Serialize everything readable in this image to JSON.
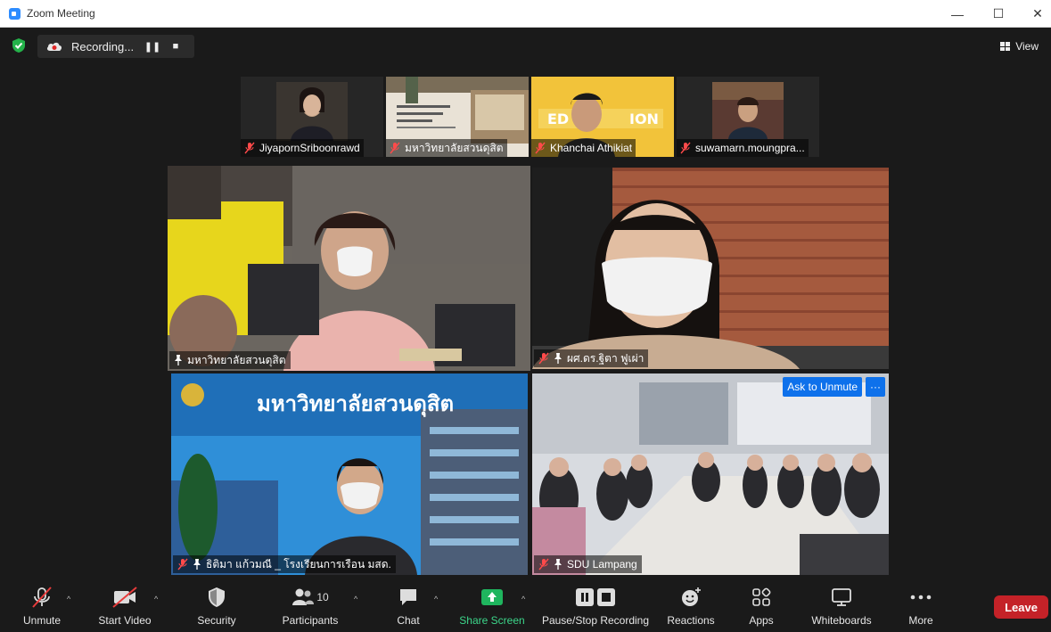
{
  "window": {
    "title": "Zoom Meeting",
    "minimize": "—",
    "maximize": "☐",
    "close": "✕"
  },
  "recording": {
    "label": "Recording...",
    "pause": "❚❚",
    "stop": "■"
  },
  "view": {
    "label": "View"
  },
  "thumbnails": [
    {
      "name": "JiyapornSriboonrawd",
      "muted": true
    },
    {
      "name": "มหาวิทยาลัยสวนดุสิต",
      "muted": true
    },
    {
      "name": "Khanchai Athikiat",
      "muted": true
    },
    {
      "name": "suwamarn.moungpra...",
      "muted": true
    }
  ],
  "tiles": [
    {
      "name": "มหาวิทยาลัยสวนดุสิต",
      "muted": false,
      "pinned": true,
      "active": true
    },
    {
      "name": "ผศ.ดร.ฐิตา ฟูเผ่า",
      "muted": true,
      "pinned": true,
      "active": false
    },
    {
      "name": "ธิติมา แก้วมณี _ โรงเรียนการเรือน มสด.",
      "muted": true,
      "pinned": true,
      "active": false,
      "banner": "มหาวิทยาลัยสวนดุสิต"
    },
    {
      "name": "SDU Lampang",
      "muted": true,
      "pinned": true,
      "active": false,
      "ask_to_unmute": "Ask to Unmute",
      "more": "···"
    }
  ],
  "toolbar": {
    "unmute": "Unmute",
    "start_video": "Start Video",
    "security": "Security",
    "participants": "Participants",
    "participants_count": "10",
    "chat": "Chat",
    "share_screen": "Share Screen",
    "pause_stop_recording": "Pause/Stop Recording",
    "reactions": "Reactions",
    "apps": "Apps",
    "whiteboards": "Whiteboards",
    "more": "More",
    "leave": "Leave",
    "caret": "^"
  },
  "colors": {
    "accent_blue": "#0e71eb",
    "active_speaker": "#c6e05b",
    "leave_red": "#c42228",
    "share_green": "#3cd68a"
  }
}
